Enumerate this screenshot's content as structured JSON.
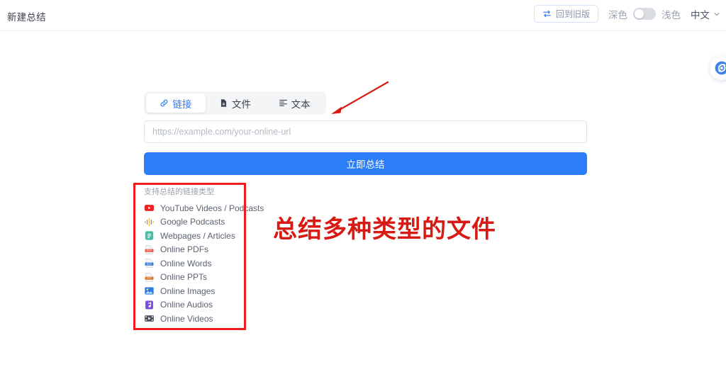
{
  "header": {
    "title": "新建总结",
    "legacy_button": {
      "label": "回到旧版",
      "icon": "swap-icon"
    },
    "theme": {
      "dark_label": "深色",
      "light_label": "浅色",
      "selected": "浅色"
    },
    "language": {
      "label": "中文",
      "icon": "chevron-down-icon"
    }
  },
  "widget": {
    "icon": "spiral-logo-icon"
  },
  "main": {
    "tabs": [
      {
        "label": "链接",
        "icon": "link-icon",
        "active": true
      },
      {
        "label": "文件",
        "icon": "file-icon",
        "active": false
      },
      {
        "label": "文本",
        "icon": "text-icon",
        "active": false
      }
    ],
    "url_field": {
      "value": "",
      "placeholder": "https://example.com/your-online-url"
    },
    "submit_label": "立即总结"
  },
  "supported_types": {
    "title": "支持总结的链接类型",
    "items": [
      {
        "label": "YouTube Videos / Podcasts",
        "icon": "youtube-icon",
        "color": "#ef2222"
      },
      {
        "label": "Google Podcasts",
        "icon": "google-podcasts-icon",
        "color": "#f5b63d"
      },
      {
        "label": "Webpages / Articles",
        "icon": "webpage-icon",
        "color": "#3fbfa6"
      },
      {
        "label": "Online PDFs",
        "icon": "pdf-file-icon",
        "color": "#ef5a42"
      },
      {
        "label": "Online Words",
        "icon": "word-file-icon",
        "color": "#3b7fd4"
      },
      {
        "label": "Online PPTs",
        "icon": "ppt-file-icon",
        "color": "#d9782f"
      },
      {
        "label": "Online Images",
        "icon": "image-file-icon",
        "color": "#2f7de1"
      },
      {
        "label": "Online Audios",
        "icon": "audio-file-icon",
        "color": "#7a4ce0"
      },
      {
        "label": "Online Videos",
        "icon": "video-file-icon",
        "color": "#4a4f5c"
      }
    ]
  },
  "annotations": {
    "highlight_color": "#ee1c1c",
    "arrow": {
      "icon": "arrow-icon",
      "color": "#d71a13"
    },
    "note_text": "总结多种类型的文件"
  }
}
